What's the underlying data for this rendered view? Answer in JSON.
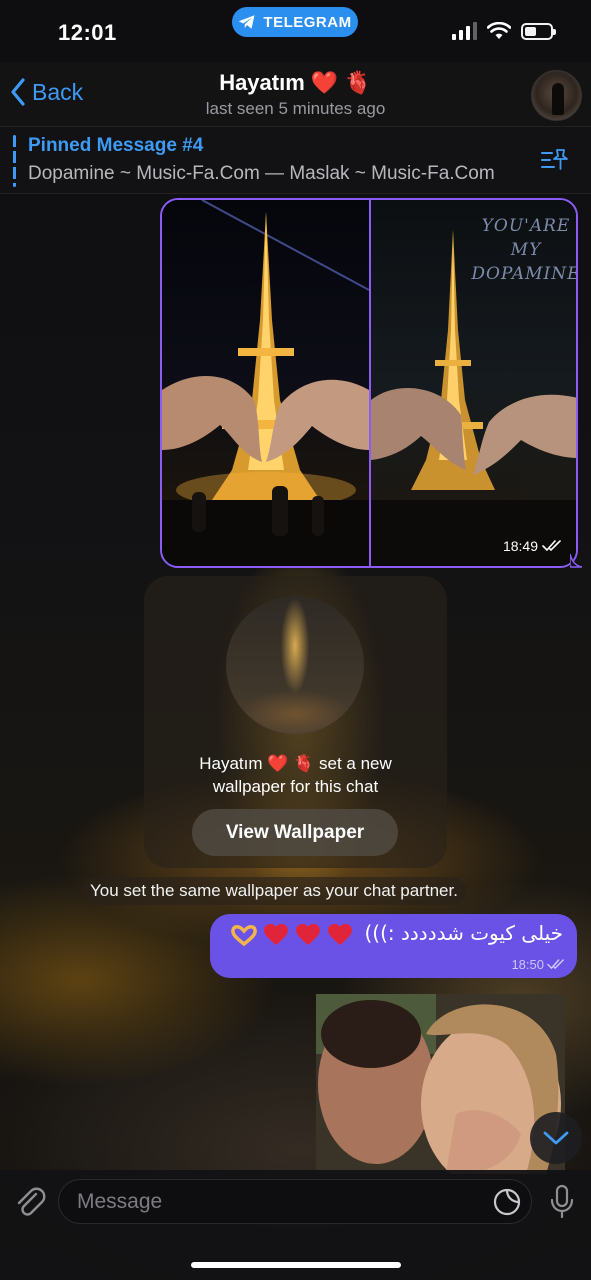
{
  "status_bar": {
    "time": "12:01",
    "app_pill": "TELEGRAM"
  },
  "header": {
    "back_label": "Back",
    "title": "Hayatım ❤️ 🫀",
    "subtitle": "last seen 5 minutes ago"
  },
  "pinned": {
    "title": "Pinned Message #4",
    "text": "Dopamine ~ Music-Fa.Com — Maslak ~ Music-Fa.Com"
  },
  "album": {
    "overlay_text": [
      "YOU'ARE",
      "MY",
      "DOPAMINE"
    ],
    "time": "18:49"
  },
  "wallpaper_card": {
    "line1": "Hayatım ❤️ 🫀  set a new",
    "line2": "wallpaper for this chat",
    "button_label": "View Wallpaper"
  },
  "service_message": "You set the same wallpaper as your chat partner.",
  "text_message": {
    "text": "خیلی کیوت شددددد :)))",
    "time": "18:50"
  },
  "input": {
    "placeholder": "Message"
  },
  "colors": {
    "accent": "#3e9bf5",
    "outgoing_bubble": "#6b52e6",
    "album_border": "#8b5cf6",
    "telegram_pill": "#2b8ff0",
    "heart": "#e0253a"
  },
  "icons": [
    "back-chevron-icon",
    "telegram-plane-icon",
    "signal-icon",
    "wifi-icon",
    "battery-icon",
    "pinned-list-icon",
    "double-check-icon",
    "heart-hands-icon",
    "heart-icon",
    "anatomical-heart-icon",
    "chevron-down-icon",
    "paperclip-icon",
    "sticker-icon",
    "microphone-icon"
  ]
}
